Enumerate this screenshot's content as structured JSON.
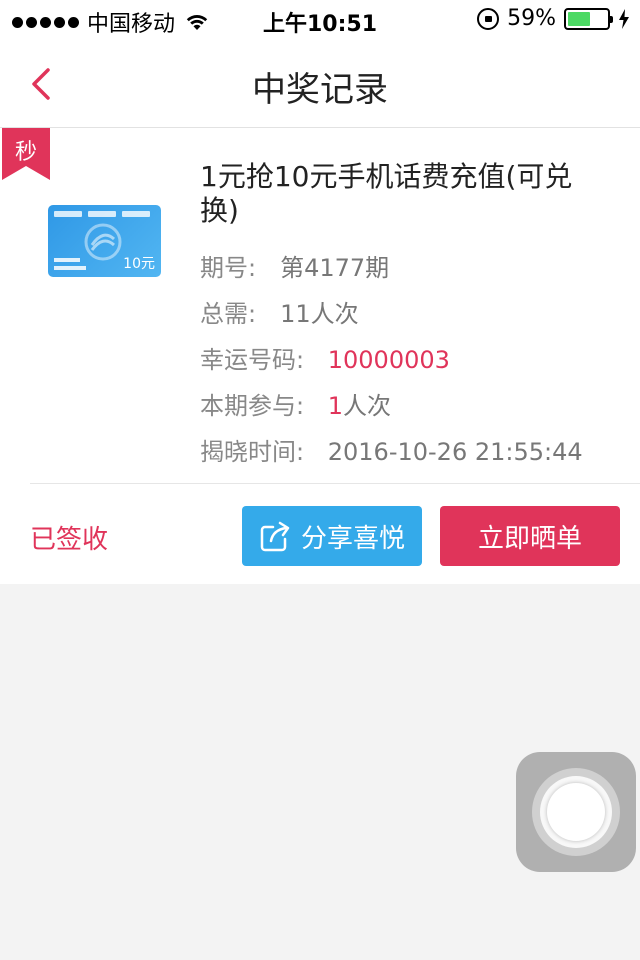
{
  "status_bar": {
    "carrier": "中国移动",
    "time": "上午10:51",
    "battery_percent": "59%",
    "battery_level": 0.59,
    "icons": [
      "signal-dots-icon",
      "wifi-icon",
      "rotation-lock-icon",
      "battery-icon",
      "charging-icon"
    ]
  },
  "nav": {
    "title": "中奖记录",
    "back_icon": "chevron-left-icon"
  },
  "record": {
    "tag": "秒",
    "title": "1元抢10元手机话费充值(可兑换)",
    "image": {
      "value": "10元"
    },
    "period_label": "期号:",
    "period_value": "第4177期",
    "total_label": "总需:",
    "total_value": "11人次",
    "lucky_label": "幸运号码:",
    "lucky_value": "10000003",
    "joined_label": "本期参与:",
    "joined_count": "1",
    "joined_unit": "人次",
    "reveal_label": "揭晓时间:",
    "reveal_value": "2016-10-26 21:55:44",
    "status": "已签收",
    "share_button": "分享喜悦",
    "share_icon": "share-icon",
    "show_button": "立即晒单"
  },
  "colors": {
    "accent_red": "#e0345a",
    "share_blue": "#34aaea",
    "battery_green": "#4cd964"
  }
}
